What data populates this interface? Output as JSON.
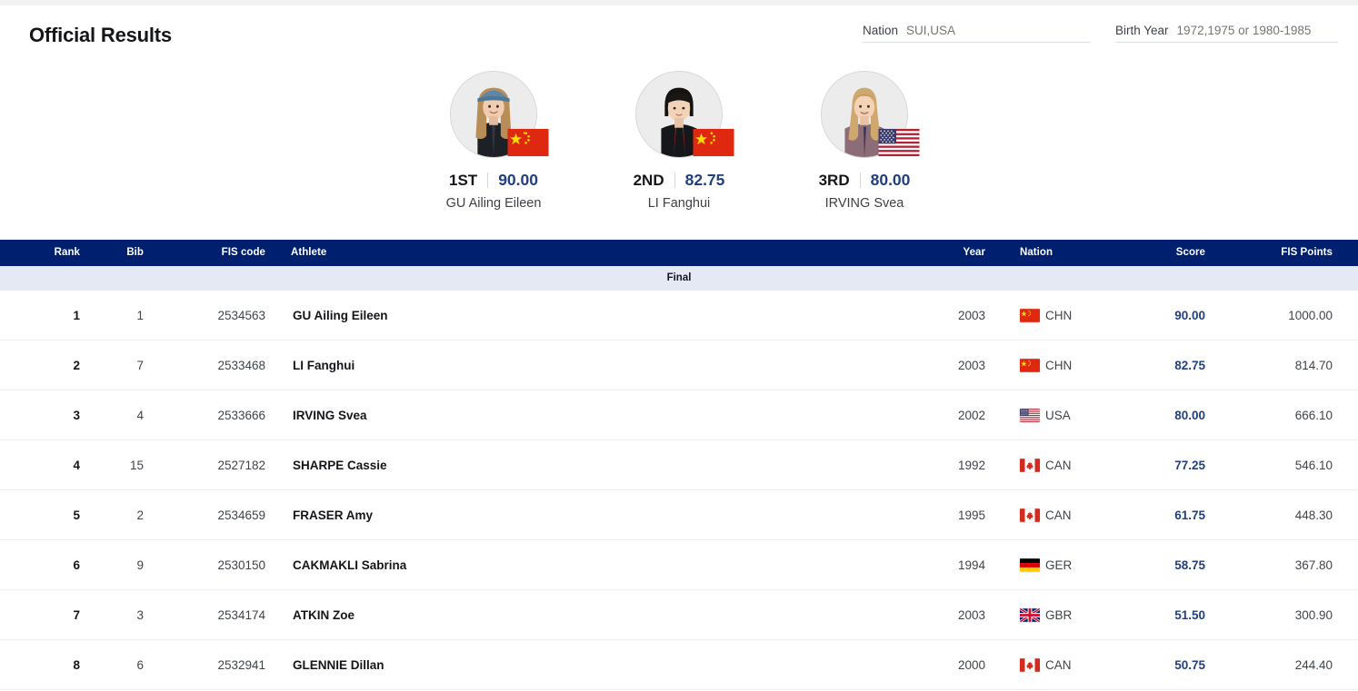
{
  "header": {
    "title": "Official Results",
    "filters": [
      {
        "name": "nation",
        "label": "Nation",
        "value": "",
        "placeholder": "SUI,USA"
      },
      {
        "name": "birth-year",
        "label": "Birth Year",
        "value": "",
        "placeholder": "1972,1975 or 1980-1985"
      }
    ]
  },
  "podium": [
    {
      "rank": "1ST",
      "score": "90.00",
      "athlete": "GU Ailing Eileen",
      "nation": "CHN",
      "flag": "cn-flag-icon",
      "avatar": "athlete-photo"
    },
    {
      "rank": "2ND",
      "score": "82.75",
      "athlete": "LI Fanghui",
      "nation": "CHN",
      "flag": "cn-flag-icon",
      "avatar": "athlete-photo"
    },
    {
      "rank": "3RD",
      "score": "80.00",
      "athlete": "IRVING Svea",
      "nation": "USA",
      "flag": "us-flag-icon",
      "avatar": "athlete-photo"
    }
  ],
  "table": {
    "columns": {
      "rank": "Rank",
      "bib": "Bib",
      "fis_code": "FIS code",
      "athlete": "Athlete",
      "year": "Year",
      "nation": "Nation",
      "score": "Score",
      "fis_points": "FIS Points"
    },
    "section_label": "Final",
    "rows": [
      {
        "rank": "1",
        "bib": "1",
        "fis_code": "2534563",
        "athlete": "GU Ailing Eileen",
        "year": "2003",
        "nation": "CHN",
        "flag": "cn-flag-icon",
        "score": "90.00",
        "fis_points": "1000.00"
      },
      {
        "rank": "2",
        "bib": "7",
        "fis_code": "2533468",
        "athlete": "LI Fanghui",
        "year": "2003",
        "nation": "CHN",
        "flag": "cn-flag-icon",
        "score": "82.75",
        "fis_points": "814.70"
      },
      {
        "rank": "3",
        "bib": "4",
        "fis_code": "2533666",
        "athlete": "IRVING Svea",
        "year": "2002",
        "nation": "USA",
        "flag": "us-flag-icon",
        "score": "80.00",
        "fis_points": "666.10"
      },
      {
        "rank": "4",
        "bib": "15",
        "fis_code": "2527182",
        "athlete": "SHARPE Cassie",
        "year": "1992",
        "nation": "CAN",
        "flag": "ca-flag-icon",
        "score": "77.25",
        "fis_points": "546.10"
      },
      {
        "rank": "5",
        "bib": "2",
        "fis_code": "2534659",
        "athlete": "FRASER Amy",
        "year": "1995",
        "nation": "CAN",
        "flag": "ca-flag-icon",
        "score": "61.75",
        "fis_points": "448.30"
      },
      {
        "rank": "6",
        "bib": "9",
        "fis_code": "2530150",
        "athlete": "CAKMAKLI Sabrina",
        "year": "1994",
        "nation": "GER",
        "flag": "de-flag-icon",
        "score": "58.75",
        "fis_points": "367.80"
      },
      {
        "rank": "7",
        "bib": "3",
        "fis_code": "2534174",
        "athlete": "ATKIN Zoe",
        "year": "2003",
        "nation": "GBR",
        "flag": "gb-flag-icon",
        "score": "51.50",
        "fis_points": "300.90"
      },
      {
        "rank": "8",
        "bib": "6",
        "fis_code": "2532941",
        "athlete": "GLENNIE Dillan",
        "year": "2000",
        "nation": "CAN",
        "flag": "ca-flag-icon",
        "score": "50.75",
        "fis_points": "244.40"
      }
    ]
  },
  "colors": {
    "header_blue": "#001f6e",
    "section_band": "#e4e9f4",
    "score_blue": "#22407f",
    "text_dark": "#14161a",
    "text_muted": "#a9adb5"
  }
}
